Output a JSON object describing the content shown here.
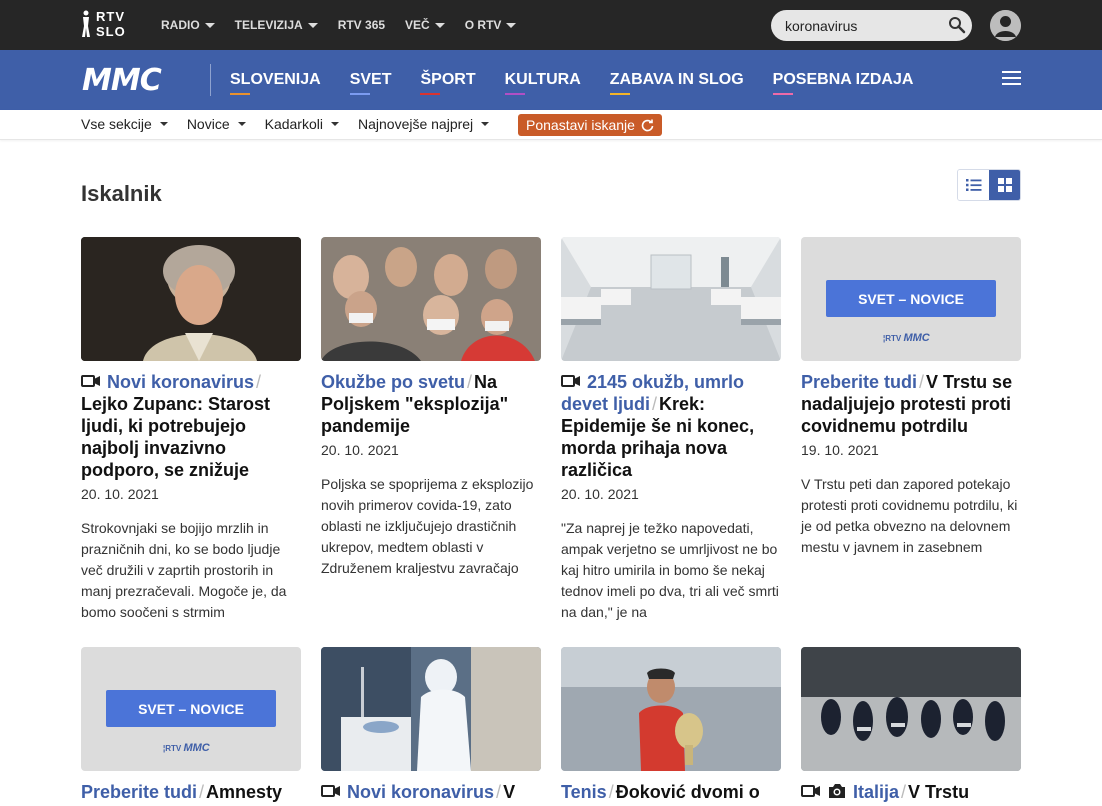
{
  "topbar": {
    "logo_line1": "RTV",
    "logo_line2": "SLO",
    "nav": [
      {
        "label": "RADIO",
        "dropdown": true
      },
      {
        "label": "TELEVIZIJA",
        "dropdown": true
      },
      {
        "label": "RTV 365",
        "dropdown": false
      },
      {
        "label": "VEČ",
        "dropdown": true
      },
      {
        "label": "O RTV",
        "dropdown": true
      }
    ],
    "search_value": "koronavirus"
  },
  "mmcbar": {
    "logo": "MMC",
    "nav": [
      {
        "label": "SLOVENIJA",
        "color": "#e8912d"
      },
      {
        "label": "SVET",
        "color": "#7b9bf0"
      },
      {
        "label": "ŠPORT",
        "color": "#d9332f"
      },
      {
        "label": "KULTURA",
        "color": "#b14fc5"
      },
      {
        "label": "ZABAVA IN SLOG",
        "color": "#f2b428"
      },
      {
        "label": "POSEBNA IZDAJA",
        "color": "#ee6aa8"
      }
    ]
  },
  "filters": {
    "items": [
      "Vse sekcije",
      "Novice",
      "Kadarkoli",
      "Najnovejše najprej"
    ],
    "reset_label": "Ponastavi iskanje"
  },
  "page": {
    "title": "Iskalnik"
  },
  "colors": {
    "accent": "#3f5fa8",
    "reset": "#c95b28",
    "topbar": "#262626"
  },
  "cards": [
    {
      "kicker": "Novi koronavirus",
      "title": "Lejko Zupanc: Starost ljudi, ki potrebujejo najbolj invazivno podporo, se znižuje",
      "date": "20. 10. 2021",
      "excerpt": "Strokovnjaki se bojijo mrzlih in prazničnih dni, ko se bodo ljudje več družili v zaprtih prostorih in manj prezračevali. Mogoče je, da bomo soočeni s strmim",
      "icons": [
        "video"
      ]
    },
    {
      "kicker": "Okužbe po svetu",
      "title": "Na Poljskem \"eksplozija\" pandemije",
      "date": "20. 10. 2021",
      "excerpt": "Poljska se spoprijema z eksplozijo novih primerov covida-19, zato oblasti ne izključujejo drastičnih ukrepov, medtem oblasti v Združenem kraljestvu zavračajo",
      "icons": []
    },
    {
      "kicker": "2145 okužb, umrlo devet ljudi",
      "title": "Krek: Epidemije še ni konec, morda prihaja nova različica",
      "date": "20. 10. 2021",
      "excerpt": "\"Za naprej je težko napovedati, ampak verjetno se umrljivost ne bo kaj hitro umirila in bomo še nekaj tednov imeli po dva, tri ali več smrti na dan,\" je na",
      "icons": [
        "video"
      ]
    },
    {
      "kicker": "Preberite tudi",
      "title": "V Trstu se nadaljujejo protesti proti covidnemu potrdilu",
      "date": "19. 10. 2021",
      "excerpt": "V Trstu peti dan zapored potekajo protesti proti covidnemu potrdilu, ki je od petka obvezno na delovnem mestu v javnem in zasebnem",
      "icons": [],
      "placeholder": "SVET – NOVICE"
    },
    {
      "kicker": "Preberite tudi",
      "title": "Amnesty",
      "date": "",
      "excerpt": "",
      "icons": [],
      "placeholder": "SVET – NOVICE"
    },
    {
      "kicker": "Novi koronavirus",
      "title": "V",
      "date": "",
      "excerpt": "",
      "icons": [
        "video"
      ]
    },
    {
      "kicker": "Tenis",
      "title": "Đoković dvomi o",
      "date": "",
      "excerpt": "",
      "icons": []
    },
    {
      "kicker": "Italija",
      "title": "V Trstu",
      "date": "",
      "excerpt": "",
      "icons": [
        "video",
        "camera"
      ]
    }
  ],
  "placeholder_logo": "MMC"
}
